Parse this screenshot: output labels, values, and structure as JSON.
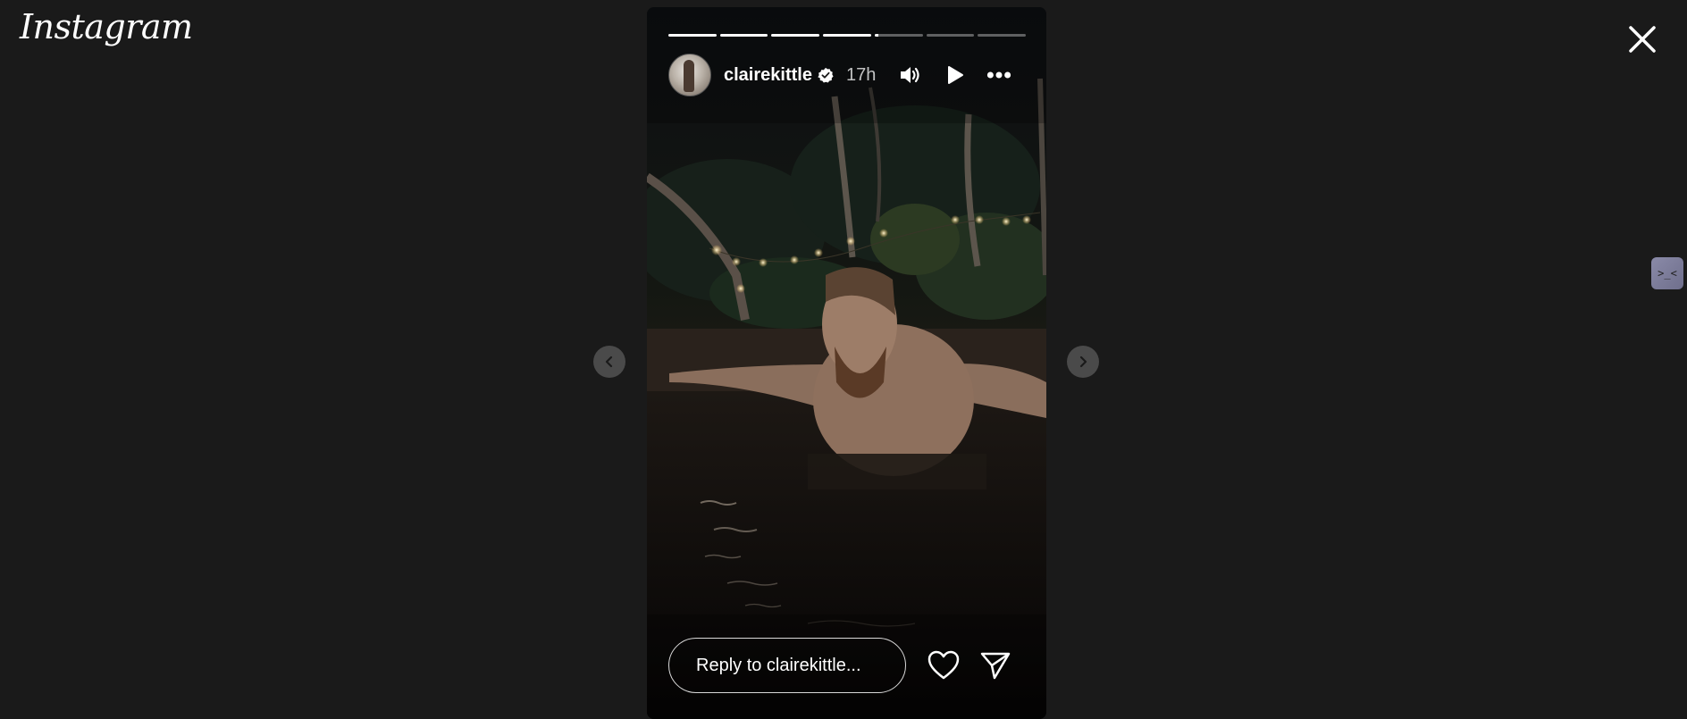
{
  "app": {
    "logo_text": "Instagram"
  },
  "story": {
    "username": "clairekittle",
    "time_ago": "17h",
    "verified": true,
    "progress": {
      "total_segments": 7,
      "completed_segments": 4,
      "current_segment_fraction": 0.08
    },
    "reply_placeholder": "Reply to clairekittle..."
  },
  "icons": {
    "close": "close-icon",
    "prev": "chevron-left-icon",
    "next": "chevron-right-icon",
    "mute": "speaker-icon",
    "play": "play-icon",
    "more": "more-options-icon",
    "like": "heart-icon",
    "share": "send-icon",
    "extension": "extension-icon"
  },
  "colors": {
    "background": "#1a1a1a",
    "nav_button": "#4a4a4a",
    "verified_badge": "#ffffff"
  },
  "extension": {
    "glyph": ">_<"
  }
}
